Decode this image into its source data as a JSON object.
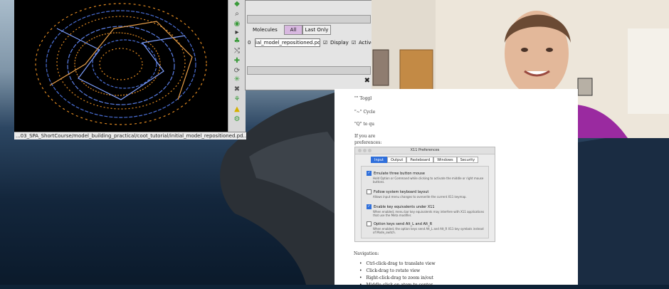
{
  "coot": {
    "status_path": "...03_SPA_ShortCourse/model_building_practical/coot_tutorial/initial_model_repositioned.pd..."
  },
  "display_manager": {
    "molecules_label": "Molecules",
    "all_button": "All",
    "last_only_button": "Last Only",
    "row_index": "0",
    "file_name": "ial_model_repositioned.pdb",
    "display_label": "Display",
    "active_label": "Active"
  },
  "document": {
    "line1": "\"\" Toggl",
    "line2": "\"~\" Cycle",
    "line3": "\"Q\" to qu",
    "line4": "If you are",
    "line5": "preferences:",
    "nav_heading": "Navigation:",
    "nav_items": [
      "Ctrl-click-drag to translate view",
      "Click-drag to rotate view",
      "Right-click-drag to zoom in/out",
      "Middle-click on atom to center"
    ]
  },
  "x11_prefs": {
    "title": "X11 Preferences",
    "tabs": [
      "Input",
      "Output",
      "Pasteboard",
      "Windows",
      "Security"
    ],
    "options": [
      {
        "label": "Emulate three button mouse",
        "checked": true,
        "desc": "Hold Option or Command while clicking to activate the middle or right mouse buttons."
      },
      {
        "label": "Follow system keyboard layout",
        "checked": false,
        "desc": "Allows input menu changes to overwrite the current X11 keymap."
      },
      {
        "label": "Enable key equivalents under X11",
        "checked": true,
        "desc": "When enabled, menu bar key equivalents may interfere with X11 applications that use the Meta modifier."
      },
      {
        "label": "Option keys send Alt_L and Alt_R",
        "checked": false,
        "desc": "When enabled, the option keys send Alt_L and Alt_R X11 key symbols instead of Mode_switch."
      }
    ]
  },
  "colors": {
    "accent": "#2f6fdb",
    "molecule_blue": "#4a6fd6",
    "molecule_orange": "#e08a22",
    "webcam_shirt": "#9a2aa0"
  }
}
